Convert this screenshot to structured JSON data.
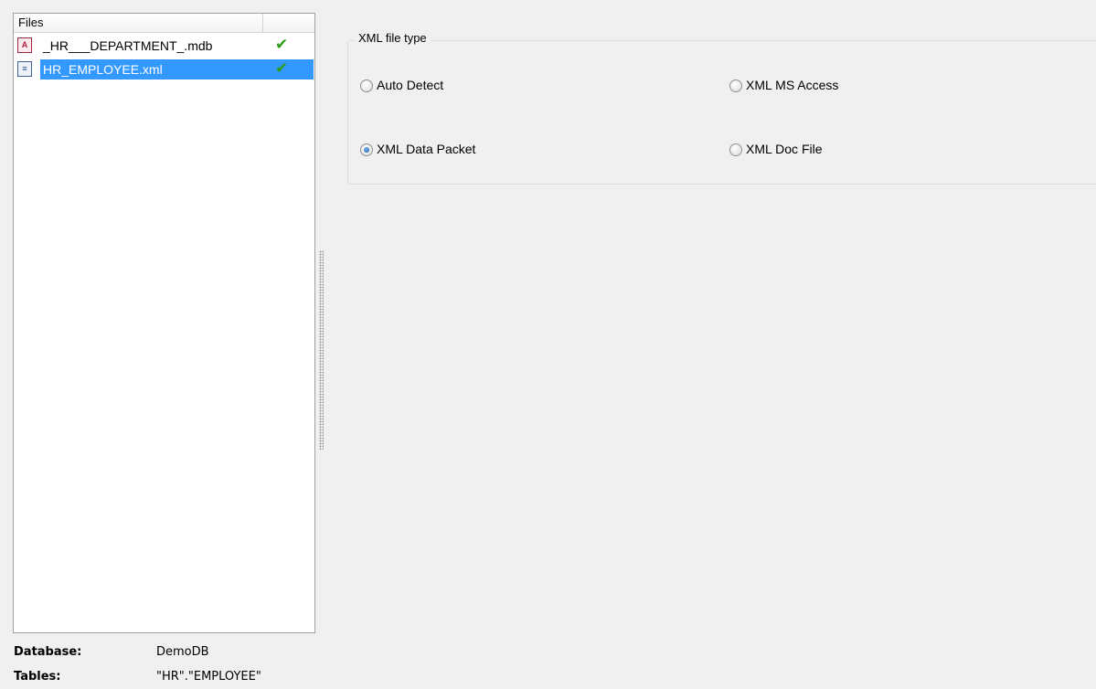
{
  "files_panel": {
    "header": "Files",
    "items": [
      {
        "name": "_HR___DEPARTMENT_.mdb",
        "icon": "mdb-file-icon",
        "status_icon": "checkmark-icon",
        "selected": false
      },
      {
        "name": "HR_EMPLOYEE.xml",
        "icon": "xml-file-icon",
        "status_icon": "checkmark-icon",
        "selected": true
      }
    ]
  },
  "info": {
    "database_label": "Database:",
    "database_value": "DemoDB",
    "tables_label": "Tables:",
    "tables_value": "\"HR\".\"EMPLOYEE\""
  },
  "xml_file_type": {
    "title": "XML file type",
    "options": [
      {
        "label": "Auto Detect",
        "checked": false
      },
      {
        "label": "XML MS Access",
        "checked": false
      },
      {
        "label": "XML Data Packet",
        "checked": true
      },
      {
        "label": "XML Doc File",
        "checked": false
      }
    ]
  },
  "colors": {
    "selection": "#3399ff",
    "check": "#2f9c1d",
    "background": "#f0f0f0"
  }
}
